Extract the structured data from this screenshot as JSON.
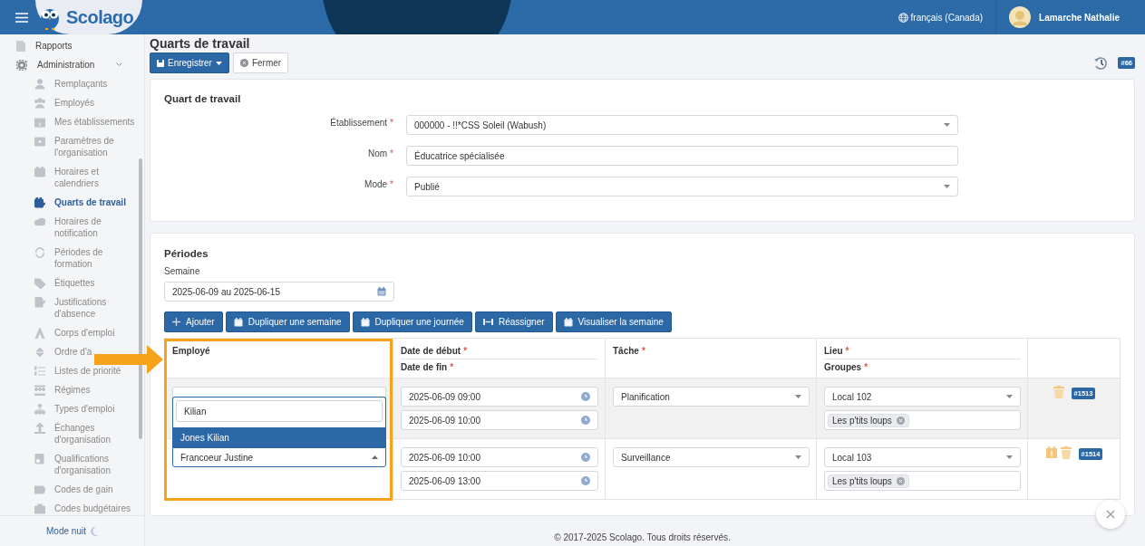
{
  "header": {
    "logo": "Scolago",
    "language": "français (Canada)",
    "user": "Lamarche Nathalie"
  },
  "sidebar": {
    "items": [
      {
        "label": "Rapports",
        "selected": false
      },
      {
        "label": "Administration",
        "selected": false,
        "expanded": true,
        "children": [
          {
            "label": "Remplaçants",
            "selected": false
          },
          {
            "label": "Employés",
            "selected": false
          },
          {
            "label": "Mes établissements",
            "selected": false
          },
          {
            "label": "Paramètres de l'organisation",
            "selected": false
          },
          {
            "label": "Horaires et calendriers",
            "selected": false
          },
          {
            "label": "Quarts de travail",
            "selected": true
          },
          {
            "label": "Horaires de notification",
            "selected": false
          },
          {
            "label": "Périodes de formation",
            "selected": false
          },
          {
            "label": "Étiquettes",
            "selected": false
          },
          {
            "label": "Justifications d'absence",
            "selected": false
          },
          {
            "label": "Corps d'emploi",
            "selected": false
          },
          {
            "label": "Ordre d'a",
            "selected": false
          },
          {
            "label": "Listes de priorité",
            "selected": false
          },
          {
            "label": "Régimes",
            "selected": false
          },
          {
            "label": "Types d'emploi",
            "selected": false
          },
          {
            "label": "Échanges d'organisation",
            "selected": false
          },
          {
            "label": "Qualifications d'organisation",
            "selected": false
          },
          {
            "label": "Codes de gain",
            "selected": false
          },
          {
            "label": "Codes budgétaires",
            "selected": false
          }
        ]
      }
    ],
    "night_mode": "Mode nuit"
  },
  "page": {
    "title": "Quarts de travail",
    "toolbar": {
      "save": "Enregistrer",
      "close": "Fermer",
      "revision": "#66"
    }
  },
  "required_mark": "*",
  "shift": {
    "title": "Quart de travail",
    "fields": [
      {
        "label": "Établissement",
        "required": true,
        "kind": "select",
        "value": "000000 - !!*CSS Soleil (Wabush)"
      },
      {
        "label": "Nom",
        "required": true,
        "kind": "text",
        "value": "Éducatrice spécialisée"
      },
      {
        "label": "Mode",
        "required": true,
        "kind": "select",
        "value": "Publié"
      }
    ]
  },
  "periods": {
    "title": "Périodes",
    "week_label": "Semaine",
    "week_value": "2025-06-09 au 2025-06-15",
    "buttons": [
      {
        "kind": "add",
        "label": "Ajouter"
      },
      {
        "kind": "calendar",
        "label": "Dupliquer une semaine"
      },
      {
        "kind": "calendar",
        "label": "Dupliquer une journée"
      },
      {
        "kind": "reassign",
        "label": "Réassigner"
      },
      {
        "kind": "calendar",
        "label": "Visualiser la semaine"
      }
    ],
    "columns": [
      {
        "label": "Employé",
        "required": false
      },
      {
        "label": "Date de début",
        "required": true,
        "sub_label": "Date de fin",
        "sub_required": true
      },
      {
        "label": "Tâche",
        "required": true
      },
      {
        "label": "Lieu",
        "required": true,
        "sub_label": "Groupes",
        "sub_required": true
      }
    ],
    "rows": [
      {
        "highlighted": true,
        "employee_expanded": false,
        "start": "2025-06-09 09:00",
        "end": "2025-06-09 10:00",
        "task": "Planification",
        "place": "Local 102",
        "groups": [
          "Les p'tits loups"
        ],
        "warning": false,
        "id": "#1513"
      },
      {
        "highlighted": false,
        "employee": "Francoeur Justine",
        "employee_expanded": true,
        "start": "2025-06-09 10:00",
        "end": "2025-06-09 13:00",
        "task": "Surveillance",
        "place": "Local 103",
        "groups": [
          "Les p'tits loups"
        ],
        "warning": true,
        "id": "#1514"
      }
    ],
    "dropdown": {
      "search_value": "Kilian",
      "options": [
        {
          "label": "Jones Kilian",
          "selected": true
        }
      ]
    }
  },
  "footer": "© 2017-2025 Scolago. Tous droits réservés."
}
